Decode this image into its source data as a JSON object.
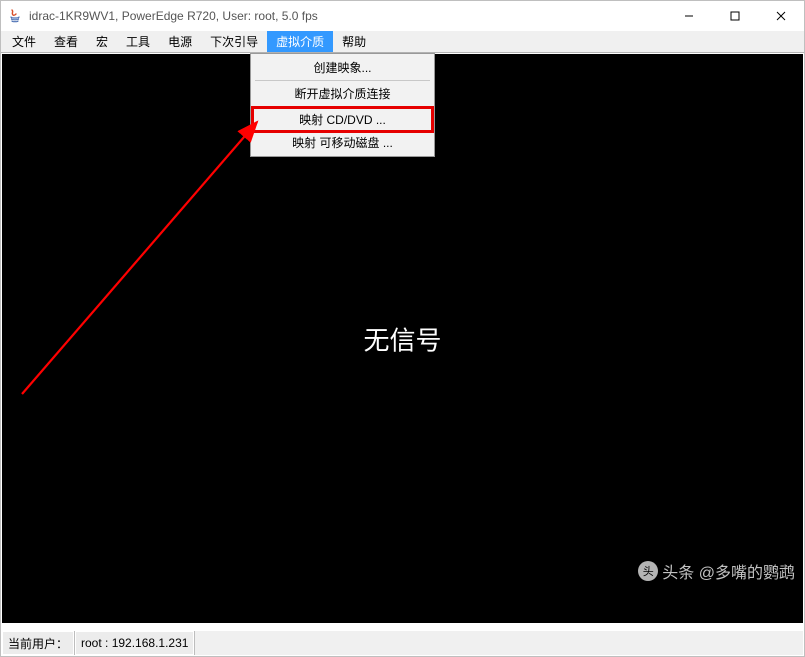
{
  "titlebar": {
    "title": "idrac-1KR9WV1, PowerEdge R720, User: root, 5.0 fps"
  },
  "menubar": {
    "items": [
      {
        "label": "文件"
      },
      {
        "label": "查看"
      },
      {
        "label": "宏"
      },
      {
        "label": "工具"
      },
      {
        "label": "电源"
      },
      {
        "label": "下次引导"
      },
      {
        "label": "虚拟介质"
      },
      {
        "label": "帮助"
      }
    ],
    "active_index": 6
  },
  "dropdown": {
    "items": [
      {
        "label": "创建映象..."
      },
      {
        "label": "断开虚拟介质连接"
      },
      {
        "label": "映射 CD/DVD ..."
      },
      {
        "label": "映射 可移动磁盘 ..."
      }
    ],
    "highlighted_index": 2
  },
  "content": {
    "no_signal_text": "无信号"
  },
  "statusbar": {
    "user_label": "当前用户：",
    "user_value": "root : 192.168.1.231"
  },
  "watermark": {
    "text": "头条 @多嘴的鹦鹉"
  }
}
